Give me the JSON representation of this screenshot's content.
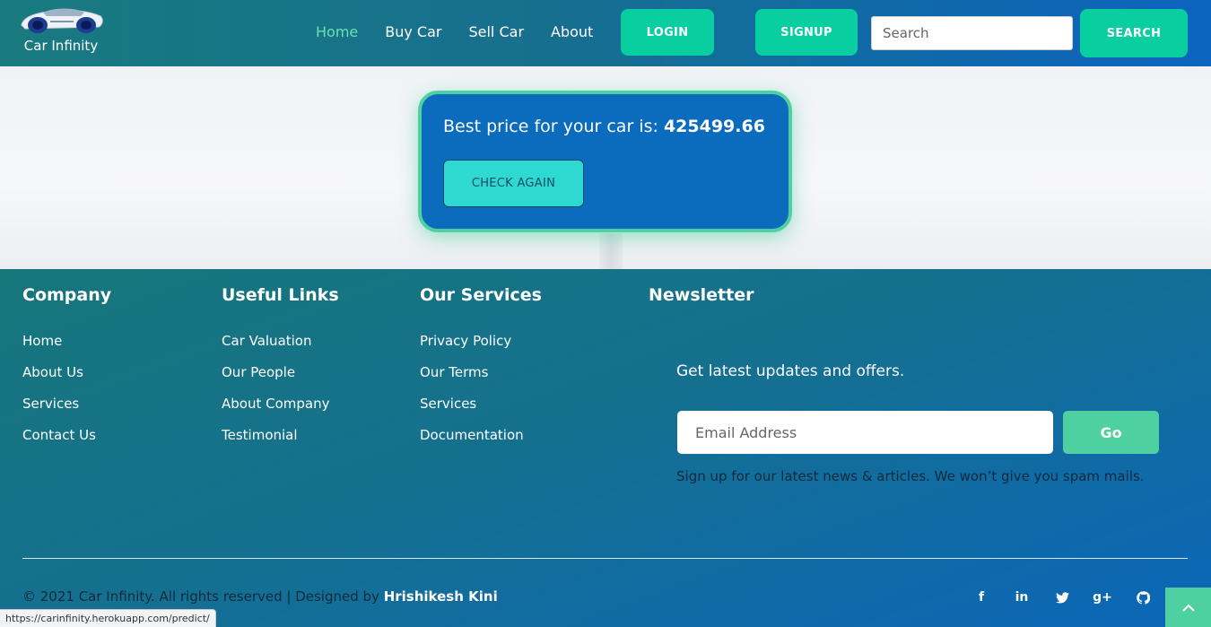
{
  "navbar": {
    "brand": "Car Infinity",
    "links": [
      "Home",
      "Buy Car",
      "Sell Car",
      "About"
    ],
    "login_label": "LOGIN",
    "signup_label": "SIGNUP",
    "search_placeholder": "Search",
    "search_label": "SEARCH"
  },
  "result": {
    "price_label": "Best price for your car is:",
    "price_value": "425499.66",
    "button_label": "CHECK AGAIN"
  },
  "footer": {
    "columns": [
      {
        "heading": "Company",
        "links": [
          "Home",
          "About Us",
          "Services",
          "Contact Us"
        ]
      },
      {
        "heading": "Useful Links",
        "links": [
          "Car Valuation",
          "Our People",
          "About Company",
          "Testimonial"
        ]
      },
      {
        "heading": "Our Services",
        "links": [
          "Privacy Policy",
          "Our Terms",
          "Services",
          "Documentation"
        ]
      }
    ],
    "newsletter": {
      "heading": "Newsletter",
      "subheading": "Get latest updates and offers.",
      "email_placeholder": "Email Address",
      "go_label": "Go",
      "note": "Sign up for our latest news & articles. We won’t give you spam mails."
    },
    "copyright": "© 2021 Car Infinity. All rights reserved | Designed by",
    "designer": "Hrishikesh Kini",
    "socials": [
      {
        "icon": "facebook-icon",
        "glyph": "f"
      },
      {
        "icon": "linkedin-icon",
        "glyph": "in"
      },
      {
        "icon": "twitter-icon",
        "glyph": ""
      },
      {
        "icon": "google-plus-icon",
        "glyph": "g+"
      },
      {
        "icon": "github-icon",
        "glyph": ""
      }
    ]
  },
  "status_url": "https://carinfinity.herokuapp.com/predict/",
  "colors": {
    "accent_green": "#08cea0",
    "card_blue": "#0b6bbd",
    "card_border": "#4fd0a0",
    "nav_active": "#6ee0ae"
  }
}
